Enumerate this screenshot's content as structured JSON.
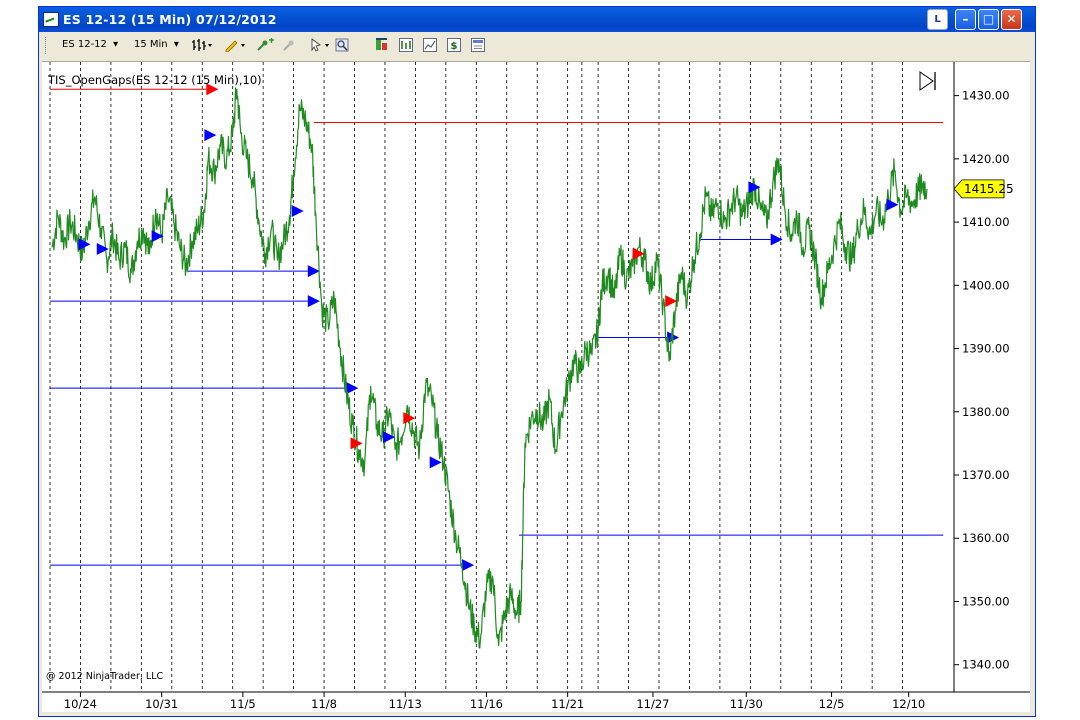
{
  "window": {
    "title": "ES 12-12 (15 Min)  07/12/2012",
    "l_button": "L",
    "min_glyph": "–",
    "max_glyph": "□",
    "close_glyph": "✕"
  },
  "toolbar": {
    "instrument": "ES 12-12",
    "interval": "15 Min",
    "dropdown_glyph": "▾",
    "icons": [
      "bar-type-icon",
      "drawing-pencil-icon",
      "add-indicator-icon",
      "strategy-icon",
      "cursor-icon",
      "zoom-icon",
      "data-box-icon",
      "chart-trader-icon",
      "chart-style-icon",
      "dollar-icon",
      "properties-icon"
    ]
  },
  "chart": {
    "indicator_label": "TIS_OpenGaps(ES 12-12 (15 Min),10)",
    "copyright": "@ 2012 NinjaTrader, LLC",
    "current_price": "1415.25",
    "scroll_end_glyph": "▷|",
    "colors": {
      "price": "#1f8a1f",
      "gap_up": "#0000ff",
      "gap_down": "#ff0000",
      "grid": "#000000",
      "price_marker": "#ffff00"
    }
  },
  "chart_data": {
    "type": "line",
    "title": "TIS_OpenGaps(ES 12-12 (15 Min),10)",
    "instrument": "ES 12-12",
    "interval": "15 Min",
    "ylim": [
      1336,
      1435
    ],
    "yticks": [
      "1430.00",
      "1420.00",
      "1410.00",
      "1400.00",
      "1390.00",
      "1380.00",
      "1370.00",
      "1360.00",
      "1350.00",
      "1340.00"
    ],
    "ytick_values": [
      1430,
      1420,
      1410,
      1400,
      1390,
      1380,
      1370,
      1360,
      1350,
      1340
    ],
    "xticks": [
      "10/24",
      "10/31",
      "11/5",
      "11/8",
      "11/13",
      "11/16",
      "11/21",
      "11/27",
      "11/30",
      "12/5",
      "12/10"
    ],
    "xtick_index": [
      1.5,
      5.5,
      9.5,
      13.5,
      17.5,
      21.5,
      25.5,
      29.7,
      34.3,
      38.5,
      42.3
    ],
    "session_separators": [
      0,
      1.5,
      3,
      4.5,
      6,
      7.5,
      9,
      10.5,
      12,
      13.5,
      15,
      16.5,
      18,
      19.5,
      21,
      22.5,
      24,
      25.5,
      26.2,
      27,
      28.5,
      30,
      31.5,
      33,
      34.5,
      36,
      37.5,
      39,
      40.5,
      42
    ],
    "price_path": [
      [
        0.1,
        1406
      ],
      [
        0.4,
        1411
      ],
      [
        0.7,
        1407
      ],
      [
        1.0,
        1410
      ],
      [
        1.3,
        1408
      ],
      [
        1.6,
        1405
      ],
      [
        1.9,
        1410
      ],
      [
        2.2,
        1414
      ],
      [
        2.5,
        1409
      ],
      [
        2.8,
        1404
      ],
      [
        3.1,
        1408
      ],
      [
        3.4,
        1404
      ],
      [
        3.7,
        1406
      ],
      [
        4.0,
        1402
      ],
      [
        4.3,
        1407
      ],
      [
        4.6,
        1409
      ],
      [
        4.9,
        1405
      ],
      [
        5.2,
        1412
      ],
      [
        5.5,
        1408
      ],
      [
        5.8,
        1414
      ],
      [
        6.1,
        1410
      ],
      [
        6.4,
        1406
      ],
      [
        6.7,
        1403
      ],
      [
        7.0,
        1407
      ],
      [
        7.3,
        1409
      ],
      [
        7.6,
        1412
      ],
      [
        7.8,
        1420
      ],
      [
        8.1,
        1418
      ],
      [
        8.4,
        1422
      ],
      [
        8.7,
        1420
      ],
      [
        9.0,
        1424
      ],
      [
        9.2,
        1431
      ],
      [
        9.4,
        1424
      ],
      [
        9.7,
        1420
      ],
      [
        10.0,
        1417
      ],
      [
        10.3,
        1410
      ],
      [
        10.6,
        1405
      ],
      [
        10.9,
        1409
      ],
      [
        11.2,
        1404
      ],
      [
        11.5,
        1407
      ],
      [
        11.8,
        1411
      ],
      [
        12.0,
        1418
      ],
      [
        12.3,
        1428
      ],
      [
        12.6,
        1426
      ],
      [
        12.9,
        1422
      ],
      [
        13.1,
        1411
      ],
      [
        13.4,
        1396
      ],
      [
        13.7,
        1394
      ],
      [
        14.0,
        1398
      ],
      [
        14.3,
        1390
      ],
      [
        14.6,
        1383
      ],
      [
        14.9,
        1378
      ],
      [
        15.2,
        1374
      ],
      [
        15.5,
        1372
      ],
      [
        15.8,
        1384
      ],
      [
        16.1,
        1378
      ],
      [
        16.4,
        1376
      ],
      [
        16.7,
        1380
      ],
      [
        17.0,
        1374
      ],
      [
        17.3,
        1376
      ],
      [
        17.6,
        1381
      ],
      [
        17.9,
        1377
      ],
      [
        18.2,
        1374
      ],
      [
        18.5,
        1384
      ],
      [
        18.8,
        1382
      ],
      [
        19.1,
        1376
      ],
      [
        19.4,
        1372
      ],
      [
        19.7,
        1366
      ],
      [
        20.0,
        1360
      ],
      [
        20.3,
        1356
      ],
      [
        20.6,
        1350
      ],
      [
        20.9,
        1346
      ],
      [
        21.2,
        1344
      ],
      [
        21.5,
        1352
      ],
      [
        21.8,
        1354
      ],
      [
        22.1,
        1343
      ],
      [
        22.4,
        1348
      ],
      [
        22.7,
        1351
      ],
      [
        23.0,
        1348
      ],
      [
        23.2,
        1350
      ],
      [
        23.4,
        1375
      ],
      [
        23.7,
        1379
      ],
      [
        24.0,
        1380
      ],
      [
        24.3,
        1378
      ],
      [
        24.6,
        1382
      ],
      [
        24.9,
        1374
      ],
      [
        25.2,
        1380
      ],
      [
        25.5,
        1384
      ],
      [
        25.8,
        1388
      ],
      [
        26.1,
        1386
      ],
      [
        26.4,
        1390
      ],
      [
        26.7,
        1389
      ],
      [
        27.0,
        1393
      ],
      [
        27.2,
        1400
      ],
      [
        27.5,
        1402
      ],
      [
        27.8,
        1398
      ],
      [
        28.1,
        1405
      ],
      [
        28.4,
        1401
      ],
      [
        28.7,
        1403
      ],
      [
        29.0,
        1406
      ],
      [
        29.3,
        1404
      ],
      [
        29.6,
        1400
      ],
      [
        29.9,
        1404
      ],
      [
        30.2,
        1397
      ],
      [
        30.5,
        1388
      ],
      [
        30.8,
        1396
      ],
      [
        31.1,
        1402
      ],
      [
        31.4,
        1398
      ],
      [
        31.7,
        1404
      ],
      [
        32.0,
        1408
      ],
      [
        32.3,
        1414
      ],
      [
        32.6,
        1411
      ],
      [
        32.9,
        1413
      ],
      [
        33.2,
        1410
      ],
      [
        33.5,
        1412
      ],
      [
        33.8,
        1414
      ],
      [
        34.1,
        1411
      ],
      [
        34.4,
        1413
      ],
      [
        34.7,
        1416
      ],
      [
        35.0,
        1412
      ],
      [
        35.3,
        1410
      ],
      [
        35.6,
        1416
      ],
      [
        35.9,
        1420
      ],
      [
        36.2,
        1412
      ],
      [
        36.5,
        1408
      ],
      [
        36.8,
        1411
      ],
      [
        37.1,
        1406
      ],
      [
        37.4,
        1409
      ],
      [
        37.7,
        1404
      ],
      [
        38.0,
        1398
      ],
      [
        38.3,
        1402
      ],
      [
        38.6,
        1406
      ],
      [
        38.9,
        1410
      ],
      [
        39.2,
        1406
      ],
      [
        39.5,
        1404
      ],
      [
        39.8,
        1409
      ],
      [
        40.1,
        1412
      ],
      [
        40.4,
        1408
      ],
      [
        40.7,
        1412
      ],
      [
        41.0,
        1410
      ],
      [
        41.3,
        1414
      ],
      [
        41.6,
        1418
      ],
      [
        41.9,
        1412
      ],
      [
        42.2,
        1414
      ],
      [
        42.5,
        1413
      ],
      [
        42.8,
        1415
      ],
      [
        43.0,
        1416
      ],
      [
        43.2,
        1415.25
      ]
    ],
    "gap_lines": [
      {
        "color": "gap_down",
        "start": 0.0,
        "end": 7.7,
        "price": 1431,
        "arrow": true
      },
      {
        "color": "gap_down",
        "start": 13.0,
        "end": 44.0,
        "price": 1425.75,
        "arrow": false
      },
      {
        "color": "gap_up",
        "start": 6.8,
        "end": 12.7,
        "price": 1402.25,
        "arrow": true
      },
      {
        "color": "gap_up",
        "start": 0.0,
        "end": 12.7,
        "price": 1397.5,
        "arrow": true
      },
      {
        "color": "gap_up",
        "start": 0.0,
        "end": 14.6,
        "price": 1383.75,
        "arrow": true
      },
      {
        "color": "gap_up",
        "start": 0.0,
        "end": 20.3,
        "price": 1355.75,
        "arrow": true
      },
      {
        "color": "gap_up",
        "start": 23.1,
        "end": 44.0,
        "price": 1360.5,
        "arrow": false
      },
      {
        "color": "gap_up",
        "start": 27.0,
        "end": 30.4,
        "price": 1391.75,
        "arrow": true
      },
      {
        "color": "gap_up",
        "start": 32.0,
        "end": 35.5,
        "price": 1407.25,
        "arrow": true
      }
    ],
    "markers": [
      {
        "color": "gap_up",
        "x": 1.7,
        "price": 1406.5
      },
      {
        "color": "gap_up",
        "x": 2.6,
        "price": 1405.75
      },
      {
        "color": "gap_up",
        "x": 5.3,
        "price": 1407.75
      },
      {
        "color": "gap_up",
        "x": 7.9,
        "price": 1423.75
      },
      {
        "color": "gap_up",
        "x": 12.2,
        "price": 1411.75
      },
      {
        "color": "gap_down",
        "x": 15.1,
        "price": 1375
      },
      {
        "color": "gap_up",
        "x": 16.7,
        "price": 1376
      },
      {
        "color": "gap_down",
        "x": 17.7,
        "price": 1379
      },
      {
        "color": "gap_up",
        "x": 19.0,
        "price": 1372
      },
      {
        "color": "gap_down",
        "x": 29.0,
        "price": 1405
      },
      {
        "color": "gap_down",
        "x": 30.6,
        "price": 1397.5
      },
      {
        "color": "gap_up",
        "x": 34.7,
        "price": 1415.5
      },
      {
        "color": "gap_up",
        "x": 41.5,
        "price": 1412.75
      }
    ]
  }
}
